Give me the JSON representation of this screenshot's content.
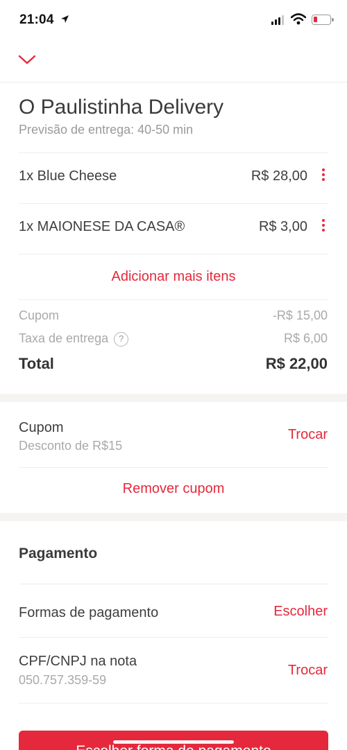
{
  "status_bar": {
    "time": "21:04"
  },
  "header": {
    "restaurant": "O Paulistinha Delivery",
    "estimate": "Previsão de entrega: 40-50 min"
  },
  "items": [
    {
      "name": "1x Blue Cheese",
      "price": "R$ 28,00"
    },
    {
      "name": "1x MAIONESE DA CASA®",
      "price": "R$ 3,00"
    }
  ],
  "add_more": "Adicionar mais itens",
  "summary": {
    "coupon_label": "Cupom",
    "coupon_value": "-R$ 15,00",
    "delivery_label": "Taxa de entrega",
    "delivery_help": "?",
    "delivery_value": "R$ 6,00",
    "total_label": "Total",
    "total_value": "R$ 22,00"
  },
  "coupon_section": {
    "title": "Cupom",
    "subtitle": "Desconto de R$15",
    "change": "Trocar",
    "remove": "Remover cupom"
  },
  "payment": {
    "heading": "Pagamento",
    "methods_label": "Formas de pagamento",
    "methods_action": "Escolher",
    "cpf_label": "CPF/CNPJ na nota",
    "cpf_value": "050.757.359-59",
    "cpf_action": "Trocar"
  },
  "cta": {
    "label": "Escolher forma de pagamento"
  },
  "colors": {
    "accent": "#e5283b",
    "text": "#3e3e3e",
    "muted": "#a9a9a9"
  }
}
